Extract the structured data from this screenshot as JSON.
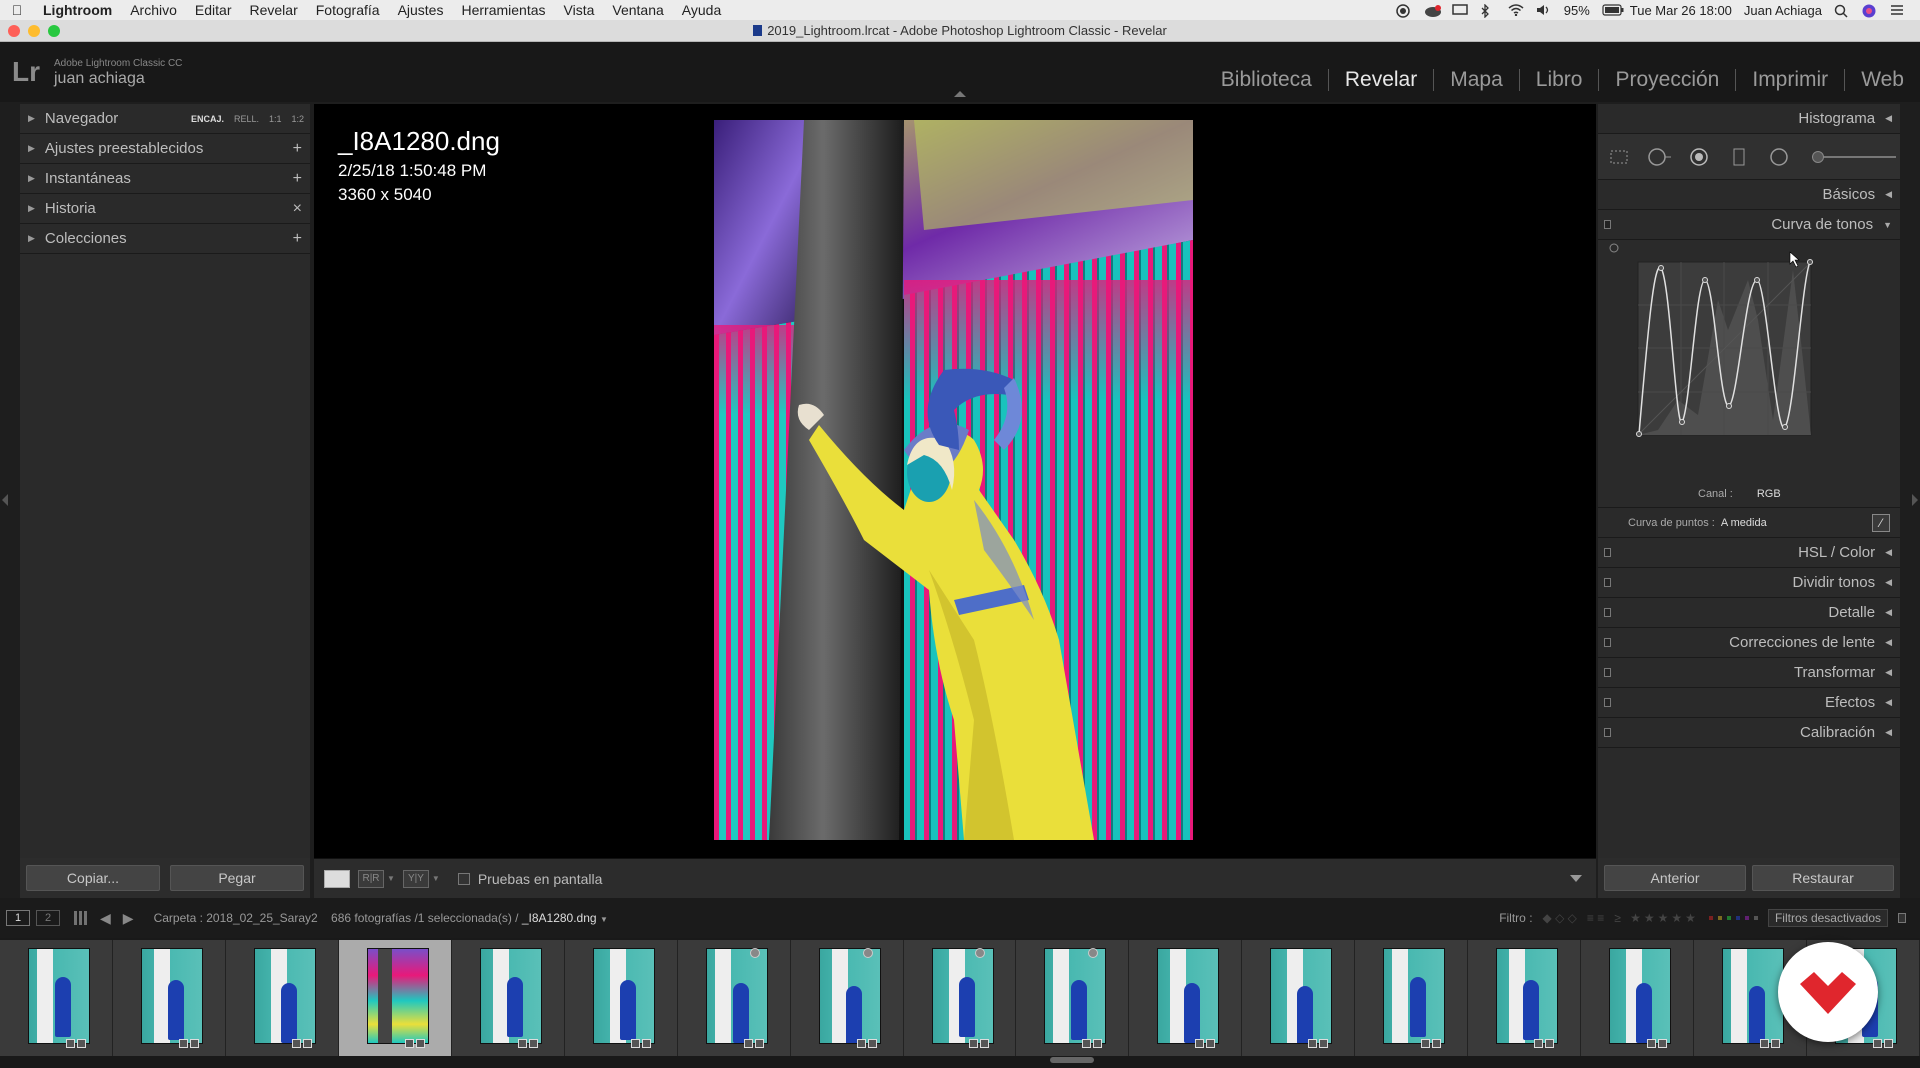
{
  "menubar": {
    "app": "Lightroom",
    "items": [
      "Archivo",
      "Editar",
      "Revelar",
      "Fotografía",
      "Ajustes",
      "Herramientas",
      "Vista",
      "Ventana",
      "Ayuda"
    ],
    "battery": "95%",
    "clock": "Tue Mar 26  18:00",
    "user": "Juan Achiaga"
  },
  "window": {
    "title": "2019_Lightroom.lrcat - Adobe Photoshop Lightroom Classic - Revelar"
  },
  "identity": {
    "logo": "Lr",
    "product": "Adobe Lightroom Classic CC",
    "user": "juan achiaga",
    "modules": [
      "Biblioteca",
      "Revelar",
      "Mapa",
      "Libro",
      "Proyección",
      "Imprimir",
      "Web"
    ],
    "active_module": "Revelar"
  },
  "left": {
    "navigator": {
      "label": "Navegador",
      "zoom": [
        "ENCAJ.",
        "RELL.",
        "1:1",
        "1:2"
      ]
    },
    "panels": [
      {
        "label": "Ajustes preestablecidos",
        "action": "+"
      },
      {
        "label": "Instantáneas",
        "action": "+"
      },
      {
        "label": "Historia",
        "action": "×"
      },
      {
        "label": "Colecciones",
        "action": "+"
      }
    ],
    "copy_button": "Copiar...",
    "paste_button": "Pegar"
  },
  "photo": {
    "filename": "_I8A1280.dng",
    "datetime": "2/25/18 1:50:48 PM",
    "dimensions": "3360 x 5040"
  },
  "toolbar": {
    "proof_label": "Pruebas en pantalla"
  },
  "right": {
    "histogram": "Histograma",
    "basics": "Básicos",
    "tone_curve": "Curva de tonos",
    "channel_label": "Canal :",
    "channel_value": "RGB",
    "point_curve_label": "Curva de puntos :",
    "point_curve_value": "A medida",
    "panels": [
      "HSL / Color",
      "Dividir tonos",
      "Detalle",
      "Correcciones de lente",
      "Transformar",
      "Efectos",
      "Calibración"
    ],
    "prev_button": "Anterior",
    "reset_button": "Restaurar"
  },
  "filmstrip": {
    "screen1": "1",
    "screen2": "2",
    "path_prefix": "Carpeta : 2018_02_25_Saray2",
    "count": "686 fotografías /1 seleccionada(s) /",
    "selected_name": "_I8A1280.dng",
    "filter_label": "Filtro :",
    "filter_value": "Filtros desactivados",
    "thumbnail_count": 17,
    "selected_index": 3
  },
  "colors": {
    "accent_pink": "#e8197a",
    "accent_cyan": "#1fc8c0",
    "accent_yellow": "#f0e046",
    "brand_red": "#e0262d"
  }
}
